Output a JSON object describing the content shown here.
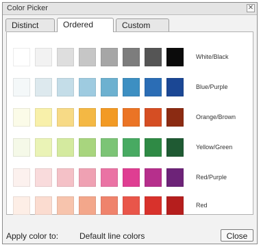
{
  "window": {
    "title": "Color Picker"
  },
  "tabs": [
    {
      "label": "Distinct",
      "active": false
    },
    {
      "label": "Ordered",
      "active": true
    },
    {
      "label": "Custom",
      "active": false
    }
  ],
  "rows": [
    {
      "label": "White/Black",
      "colors": [
        "#ffffff",
        "#f2f2f2",
        "#dedede",
        "#c6c6c6",
        "#a6a6a6",
        "#7d7d7d",
        "#555555",
        "#0b0b0b"
      ]
    },
    {
      "label": "Blue/Purple",
      "colors": [
        "#f4f8f9",
        "#dde9ee",
        "#c4dde8",
        "#9ecbe0",
        "#6db1d0",
        "#3d8fc2",
        "#2b6db5",
        "#1b4794"
      ]
    },
    {
      "label": "Orange/Brown",
      "colors": [
        "#fbfbe8",
        "#f8f0aa",
        "#f7da86",
        "#f4b844",
        "#f29a24",
        "#eb7425",
        "#d54e23",
        "#8b2b12"
      ]
    },
    {
      "label": "Yellow/Green",
      "colors": [
        "#f5f9e8",
        "#eaf3b6",
        "#d4ea9f",
        "#a8d57e",
        "#7cc476",
        "#48aa62",
        "#2f8a45",
        "#1f5a33"
      ]
    },
    {
      "label": "Red/Purple",
      "colors": [
        "#fcf1ee",
        "#f9dbdc",
        "#f4c1c7",
        "#efa1b3",
        "#ea73a4",
        "#df3e92",
        "#b62f8c",
        "#6d2378"
      ]
    },
    {
      "label": "Red",
      "colors": [
        "#fdeee6",
        "#fbdcd0",
        "#f7c4ad",
        "#f3a78b",
        "#ef836c",
        "#e9564a",
        "#d8322c",
        "#b51e1d"
      ]
    }
  ],
  "footer": {
    "apply_label": "Apply color to:",
    "apply_value": "Default line colors",
    "close_label": "Close"
  }
}
